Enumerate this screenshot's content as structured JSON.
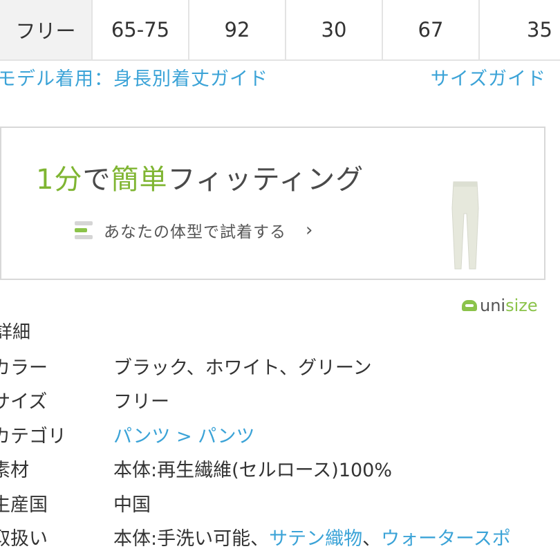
{
  "size_table": {
    "label": "フリー",
    "values": [
      "65-75",
      "92",
      "30",
      "67",
      "35"
    ]
  },
  "links": {
    "model_guide": "モデル着用：身長別着丈ガイド",
    "size_guide": "サイズガイド"
  },
  "fitting_banner": {
    "title_1": "1分",
    "title_2": "で",
    "title_3": "簡単",
    "title_4": "フィッティング",
    "cta": "あなたの体型で試着する",
    "chevron": "›"
  },
  "brand": {
    "part1": "uni",
    "part2": "size"
  },
  "details": {
    "title": "詳細",
    "rows": [
      {
        "key": "カラー",
        "value": "ブラック、ホワイト、グリーン"
      },
      {
        "key": "サイズ",
        "value": "フリー"
      },
      {
        "key": "カテゴリ",
        "link1": "パンツ",
        "sep": " > ",
        "link2": "パンツ"
      },
      {
        "key": "素材",
        "value": "本体:再生繊維(セルロース)100%"
      },
      {
        "key": "生産国",
        "value": "中国"
      },
      {
        "key": "取扱い",
        "value": "本体:手洗い可能、",
        "link1": "サテン織物",
        "sep": "、",
        "link2": "ウォータースポ"
      }
    ]
  },
  "colors": {
    "link": "#3ba3d7",
    "accent_green": "#7fb532",
    "table_label_bg": "#f2f2f2"
  },
  "icons": [
    "list-lines-icon",
    "chevron-right-icon",
    "pants-icon",
    "unisize-logo-icon"
  ]
}
